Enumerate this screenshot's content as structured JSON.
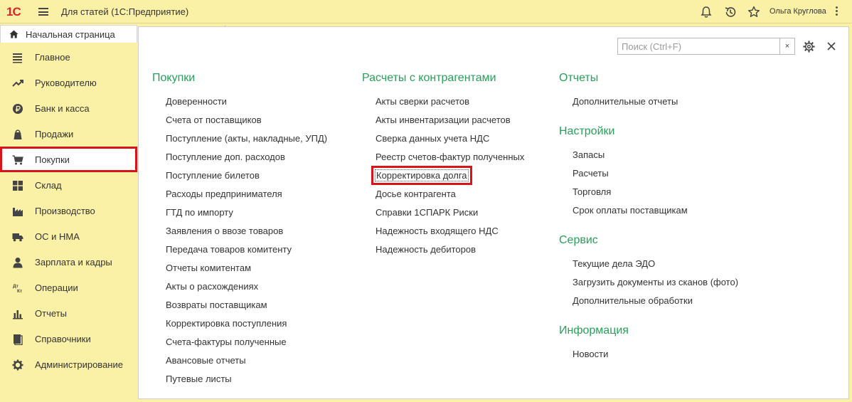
{
  "app": {
    "logo_text": "1С",
    "title": "Для статей  (1С:Предприятие)",
    "user_name": "Ольга Круглова"
  },
  "tabs": {
    "home_label": "Начальная страница"
  },
  "sidebar": {
    "items": [
      {
        "label": "Главное",
        "icon": "menu-lines-icon"
      },
      {
        "label": "Руководителю",
        "icon": "trend-icon"
      },
      {
        "label": "Банк и касса",
        "icon": "ruble-coin-icon"
      },
      {
        "label": "Продажи",
        "icon": "bag-icon"
      },
      {
        "label": "Покупки",
        "icon": "cart-icon",
        "active": true
      },
      {
        "label": "Склад",
        "icon": "grid-icon"
      },
      {
        "label": "Производство",
        "icon": "factory-icon"
      },
      {
        "label": "ОС и НМА",
        "icon": "truck-icon"
      },
      {
        "label": "Зарплата и кадры",
        "icon": "person-icon"
      },
      {
        "label": "Операции",
        "icon": "dt-kt-icon"
      },
      {
        "label": "Отчеты",
        "icon": "bars-icon"
      },
      {
        "label": "Справочники",
        "icon": "book-icon"
      },
      {
        "label": "Администрирование",
        "icon": "gear-icon"
      }
    ],
    "dt_kt_top": "Дт",
    "dt_kt_bottom": "Кт"
  },
  "search": {
    "placeholder": "Поиск (Ctrl+F)",
    "clear_label": "×"
  },
  "columns": {
    "purchases": {
      "title": "Покупки",
      "links": [
        "Доверенности",
        "Счета от поставщиков",
        "Поступление (акты, накладные, УПД)",
        "Поступление доп. расходов",
        "Поступление билетов",
        "Расходы предпринимателя",
        "ГТД по импорту",
        "Заявления о ввозе товаров",
        "Передача товаров комитенту",
        "Отчеты комитентам",
        "Акты о расхождениях",
        "Возвраты поставщикам",
        "Корректировка поступления",
        "Счета-фактуры полученные",
        "Авансовые отчеты",
        "Путевые листы"
      ]
    },
    "settlements": {
      "title": "Расчеты с контрагентами",
      "links": [
        "Акты сверки расчетов",
        "Акты инвентаризации расчетов",
        "Сверка данных учета НДС",
        "Реестр счетов-фактур полученных",
        "Корректировка долга",
        "Досье контрагента",
        "Справки 1СПАРК Риски",
        "Надежность входящего НДС",
        "Надежность дебиторов"
      ]
    },
    "reports": {
      "title": "Отчеты",
      "links": [
        "Дополнительные отчеты"
      ]
    },
    "settings": {
      "title": "Настройки",
      "links": [
        "Запасы",
        "Расчеты",
        "Торговля",
        "Срок оплаты поставщикам"
      ]
    },
    "service": {
      "title": "Сервис",
      "links": [
        "Текущие дела ЭДО",
        "Загрузить документы из сканов (фото)",
        "Дополнительные обработки"
      ]
    },
    "info": {
      "title": "Информация",
      "links": [
        "Новости"
      ]
    }
  },
  "colors": {
    "panel_bg": "#fbf1a6",
    "section_title": "#28a05a",
    "highlight": "#d7141a",
    "logo": "#d9252a"
  }
}
